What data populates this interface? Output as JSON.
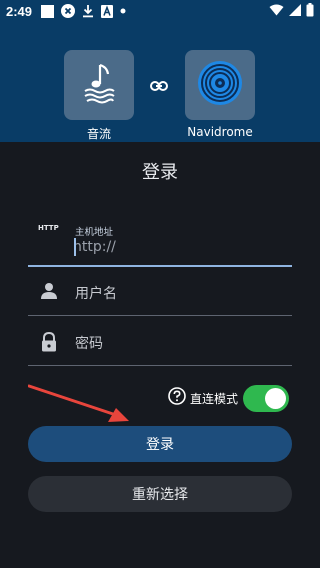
{
  "statusbar": {
    "time": "2:49",
    "icons": [
      "square-icon",
      "close-circle-icon",
      "download-icon",
      "font-icon",
      "dot-icon"
    ],
    "right_icons": [
      "wifi-icon",
      "cellular-icon",
      "battery-icon"
    ]
  },
  "header": {
    "app_left": {
      "label": "音流",
      "icon": "music-note-icon"
    },
    "link_icon": "link-icon",
    "app_right": {
      "label": "Navidrome",
      "icon": "vinyl-icon"
    }
  },
  "form": {
    "title": "登录",
    "server": {
      "tag": "HTTP",
      "label": "主机地址",
      "value": "http://"
    },
    "username": {
      "placeholder": "用户名",
      "icon": "person-icon"
    },
    "password": {
      "placeholder": "密码",
      "icon": "lock-icon"
    },
    "direct_mode": {
      "label": "直连模式",
      "enabled": true,
      "icon": "help-icon"
    }
  },
  "buttons": {
    "login": "登录",
    "reselect": "重新选择"
  },
  "colors": {
    "header_bg": "#093c66",
    "page_bg": "#16191f",
    "primary_button": "#1d4d7c",
    "toggle_on": "#2fb84f",
    "arrow": "#e8453c"
  }
}
